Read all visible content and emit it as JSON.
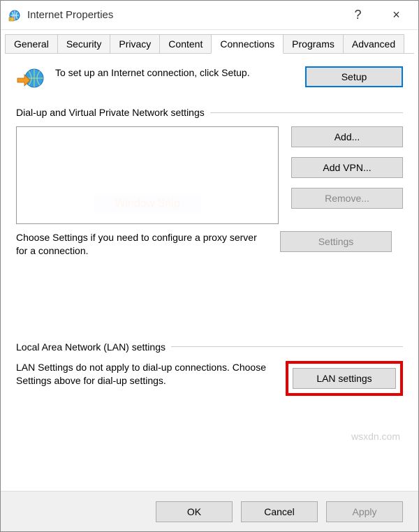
{
  "titlebar": {
    "title": "Internet Properties",
    "help": "?",
    "close": "×"
  },
  "tabs": [
    "General",
    "Security",
    "Privacy",
    "Content",
    "Connections",
    "Programs",
    "Advanced"
  ],
  "active_tab_index": 4,
  "setup": {
    "text": "To set up an Internet connection, click Setup.",
    "button": "Setup"
  },
  "dialup": {
    "legend": "Dial-up and Virtual Private Network settings",
    "add": "Add...",
    "add_vpn": "Add VPN...",
    "remove": "Remove...",
    "settings": "Settings",
    "note": "Choose Settings if you need to configure a proxy server for a connection.",
    "watermark": "Window Snip"
  },
  "lan": {
    "legend": "Local Area Network (LAN) settings",
    "text": "LAN Settings do not apply to dial-up connections. Choose Settings above for dial-up settings.",
    "button": "LAN settings"
  },
  "footer": {
    "ok": "OK",
    "cancel": "Cancel",
    "apply": "Apply"
  },
  "watermark_site": "wsxdn.com"
}
